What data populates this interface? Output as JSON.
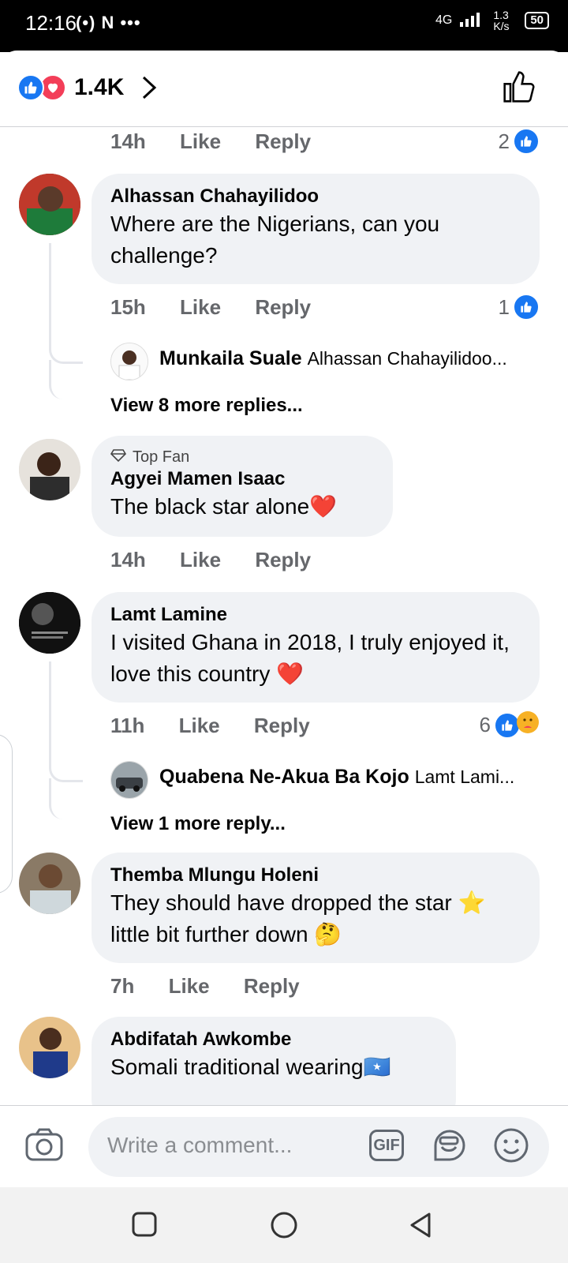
{
  "status_bar": {
    "time": "12:16",
    "left_icons": "(•) N •••",
    "network": "4G",
    "speed": "1.3 K/s",
    "battery": "50"
  },
  "header": {
    "reaction_count": "1.4K"
  },
  "comments": [
    {
      "meta_time": "14h",
      "like": "Like",
      "reply": "Reply",
      "count": "2"
    },
    {
      "name": "Alhassan Chahayilidoo",
      "text": "Where are the Nigerians, can you challenge?",
      "meta_time": "15h",
      "like": "Like",
      "reply": "Reply",
      "count": "1",
      "reply_preview": {
        "name": "Munkaila Suale",
        "snippet": "Alhassan Chahayilidoo..."
      },
      "more_replies": "View 8 more replies..."
    },
    {
      "badge": "Top Fan",
      "name": "Agyei Mamen Isaac",
      "text": "The black star alone❤️",
      "meta_time": "14h",
      "like": "Like",
      "reply": "Reply"
    },
    {
      "name": "Lamt Lamine",
      "text": "I visited Ghana in 2018, I truly enjoyed it, love this country ❤️",
      "meta_time": "11h",
      "like": "Like",
      "reply": "Reply",
      "count": "6",
      "reply_preview": {
        "name": "Quabena Ne-Akua Ba Kojo",
        "snippet": "Lamt Lami..."
      },
      "more_replies": "View 1 more reply..."
    },
    {
      "name": "Themba Mlungu Holeni",
      "text": "They should have dropped the star ⭐ little bit further down 🤔",
      "meta_time": "7h",
      "like": "Like",
      "reply": "Reply"
    },
    {
      "name": "Abdifatah Awkombe",
      "text": "Somali traditional wearing🇸🇴"
    }
  ],
  "composer": {
    "placeholder": "Write a comment...",
    "gif_label": "GIF"
  },
  "colors": {
    "accent": "#1877f2",
    "bubble": "#f0f2f5",
    "love": "#f33e58",
    "meta": "#65676b"
  },
  "icons": [
    "like-reaction-icon",
    "love-reaction-icon",
    "chevron-right-icon",
    "thumbs-up-outline-icon",
    "camera-icon",
    "gif-icon",
    "sticker-icon",
    "emoji-icon",
    "square-nav-icon",
    "circle-nav-icon",
    "back-nav-icon"
  ]
}
